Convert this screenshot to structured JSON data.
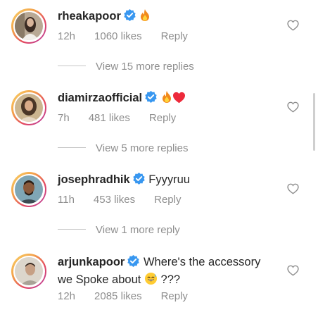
{
  "comments": [
    {
      "username": "rheakapoor",
      "text": "",
      "emoji": "fire",
      "time": "12h",
      "likes": "1060 likes",
      "reply": "Reply",
      "view_more": "View 15 more replies"
    },
    {
      "username": "diamirzaofficial",
      "text": "",
      "emoji": "fire-heart",
      "time": "7h",
      "likes": "481 likes",
      "reply": "Reply",
      "view_more": "View 5 more replies"
    },
    {
      "username": "josephradhik",
      "text": "Fyyyruu",
      "time": "11h",
      "likes": "453 likes",
      "reply": "Reply",
      "view_more": "View 1 more reply"
    },
    {
      "username": "arjunkapoor",
      "text_line1": "Where's the accessory",
      "text_line2_a": "we Spoke about",
      "text_line2_b": "???",
      "emoji": "sweat-smile",
      "time": "12h",
      "likes": "2085 likes",
      "reply": "Reply"
    }
  ],
  "colors": {
    "verified": "#3897f0",
    "muted": "#8e8e8e",
    "text": "#262626",
    "heart_red": "#ed2a3b",
    "fire": "#f5a623"
  },
  "icons": [
    "verified-badge-icon",
    "fire-emoji-icon",
    "red-heart-emoji-icon",
    "sweat-smile-emoji-icon",
    "like-heart-icon"
  ]
}
